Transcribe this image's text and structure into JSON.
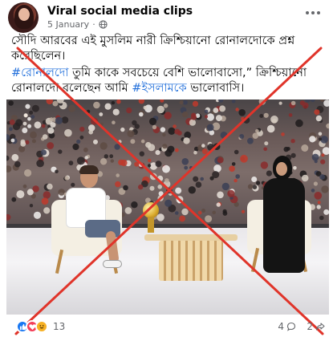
{
  "post": {
    "author": "Viral social media clips",
    "date": "5 January",
    "separator": "·",
    "privacy_icon": "globe-icon",
    "paragraph1": "সৌদি আরবের এই মুসলিম নারী ক্রিশ্চিয়ানো রোনালদোকে প্রশ্ন করেছিলেন।",
    "hashtag": "#রোনালদো",
    "paragraph2_a": " তুমি কাকে সবচেয়ে বেশি ভালোবাসো,” ক্রিশ্চিয়ানো রোনালদো বলেছেন আমি ",
    "hashtag2": "#ইসলামকে",
    "paragraph2_b": " ভালোবাসি।"
  },
  "footer": {
    "reaction_count": "13",
    "comment_count": "4",
    "share_count": "2"
  },
  "colors": {
    "hashtag": "#216fdb",
    "cross": "#e0342a",
    "like": "#1877f2",
    "love": "#f33e58"
  }
}
